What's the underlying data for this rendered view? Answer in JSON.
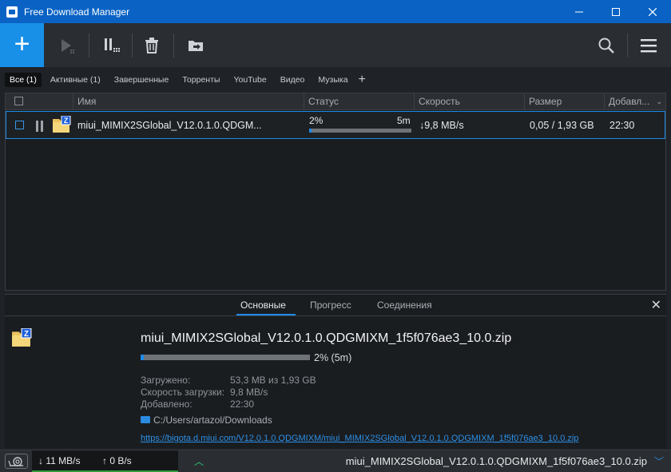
{
  "window": {
    "title": "Free Download Manager"
  },
  "toolbar": {
    "add_label": "+",
    "icons": [
      "play-icon",
      "pause-all-icon",
      "delete-icon",
      "move-icon",
      "search-icon",
      "menu-icon"
    ]
  },
  "tabs": [
    {
      "label": "Все (1)",
      "active": true
    },
    {
      "label": "Активные (1)",
      "active": false
    },
    {
      "label": "Завершенные",
      "active": false
    },
    {
      "label": "Торренты",
      "active": false
    },
    {
      "label": "YouTube",
      "active": false
    },
    {
      "label": "Видео",
      "active": false
    },
    {
      "label": "Музыка",
      "active": false
    }
  ],
  "grid": {
    "columns": [
      "Имя",
      "Статус",
      "Скорость",
      "Размер",
      "Добавл..."
    ],
    "rows": [
      {
        "name": "miui_MIMIX2SGlobal_V12.0.1.0.QDGM...",
        "status_percent": "2%",
        "status_eta": "5m",
        "progress": 0.02,
        "speed": "↓9,8 MB/s",
        "size": "0,05 / 1,93 GB",
        "added": "22:30"
      }
    ]
  },
  "details": {
    "tabs": [
      "Основные",
      "Прогресс",
      "Соединения"
    ],
    "file_name": "miui_MIMIX2SGlobal_V12.0.1.0.QDGMIXM_1f5f076ae3_10.0.zip",
    "progress_text": "2% (5m)",
    "progress": 0.02,
    "fields": [
      {
        "label": "Загружено:",
        "value": "53,3 MB из 1,93 GB"
      },
      {
        "label": "Скорость загрузки:",
        "value": "9,8 MB/s"
      },
      {
        "label": "Добавлено:",
        "value": "22:30"
      }
    ],
    "path": "C:/Users/artazol/Downloads",
    "url": "https://bigota.d.miui.com/V12.0.1.0.QDGMIXM/miui_MIMIX2SGlobal_V12.0.1.0.QDGMIXM_1f5f076ae3_10.0.zip"
  },
  "statusbar": {
    "down": "↓ 11 MB/s",
    "up": "↑ 0 B/s",
    "file": "miui_MIMIX2SGlobal_V12.0.1.0.QDGMIXM_1f5f076ae3_10.0.zip"
  },
  "colors": {
    "accent": "#1890e8",
    "titlebar": "#0a63c4",
    "background": "#1f2226"
  }
}
